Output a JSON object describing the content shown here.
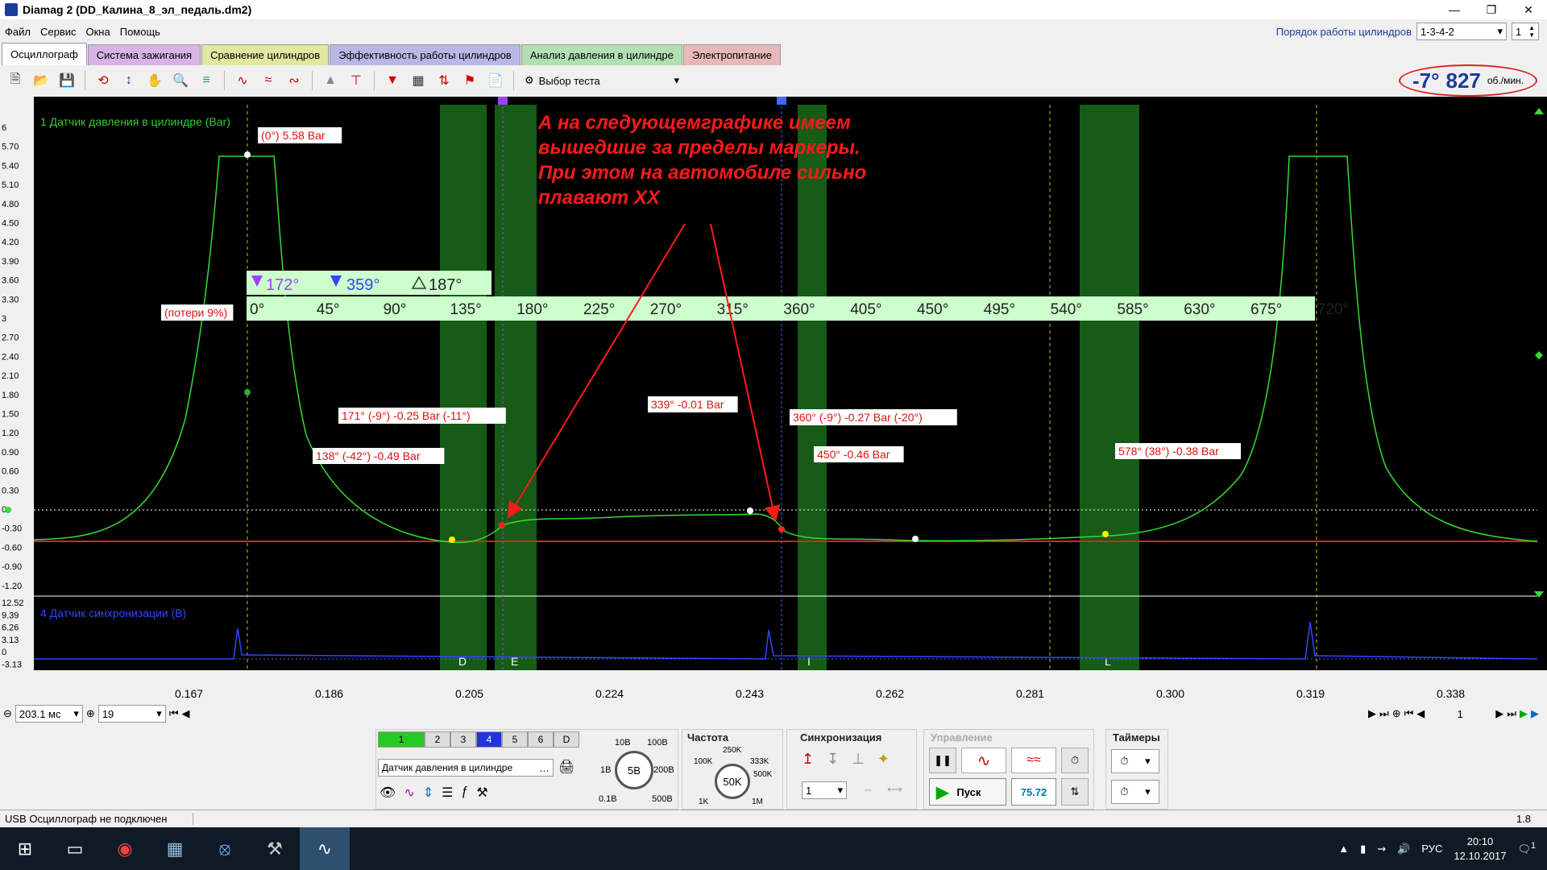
{
  "window": {
    "title": "Diamag 2 (DD_Калина_8_эл_педаль.dm2)"
  },
  "menu": [
    "Файл",
    "Сервис",
    "Окна",
    "Помощь"
  ],
  "cylinder_order": {
    "label": "Порядок работы цилиндров",
    "value": "1-3-4-2",
    "count": "1"
  },
  "tabs": [
    {
      "label": "Осциллограф",
      "color": "#ffffff"
    },
    {
      "label": "Система зажигания",
      "color": "#d9b3e6"
    },
    {
      "label": "Сравнение цилиндров",
      "color": "#e0e8a0"
    },
    {
      "label": "Эффективность работы цилиндров",
      "color": "#b8b8e8"
    },
    {
      "label": "Анализ давления в цилиндре",
      "color": "#b3e0b3"
    },
    {
      "label": "Электропитание",
      "color": "#e8b8b8"
    }
  ],
  "toolbar": {
    "test_select": "Выбор теста"
  },
  "rpm": {
    "angle": "-7°",
    "value": "827",
    "unit": "об./мин."
  },
  "scope": {
    "ch1_label": "1 Датчик давления в цилиндре (Bar)",
    "ch4_label": "4 Датчик синхронизации (В)",
    "y1_ticks": [
      "6",
      "5.70",
      "5.40",
      "5.10",
      "4.80",
      "4.50",
      "4.20",
      "3.90",
      "3.60",
      "3.30",
      "3",
      "2.70",
      "2.40",
      "2.10",
      "1.80",
      "1.50",
      "1.20",
      "0.90",
      "0.60",
      "0.30",
      "0",
      "-0.30",
      "-0.60",
      "-0.90",
      "-1.20"
    ],
    "y2_ticks": [
      "12.52",
      "9.39",
      "6.26",
      "3.13",
      "0",
      "-3.13"
    ],
    "x_ticks": [
      "0.167",
      "0.186",
      "0.205",
      "0.224",
      "0.243",
      "0.262",
      "0.281",
      "0.300",
      "0.319",
      "0.338"
    ],
    "degree_ticks": [
      "0°",
      "45°",
      "90°",
      "135°",
      "180°",
      "225°",
      "270°",
      "315°",
      "360°",
      "405°",
      "450°",
      "495°",
      "540°",
      "585°",
      "630°",
      "675°",
      "720°"
    ],
    "markers": {
      "m1": "172°",
      "m2": "359°",
      "delta": "187°"
    },
    "zones": [
      "D",
      "E",
      "I",
      "L"
    ],
    "annotation": "А на следующемграфике имеем вышедшие за пределы маркеры. При этом на автомобиле сильно плавают ХХ",
    "point_labels": [
      "(0°) 5.58 Bar",
      "(потери 9%)",
      "171° (-9°) -0.25 Bar (-11°)",
      "138° (-42°) -0.49 Bar",
      "339° -0.01 Bar",
      "360° (-9°) -0.27 Bar (-20°)",
      "450° -0.46 Bar",
      "578° (38°) -0.38 Bar"
    ]
  },
  "nav": {
    "timebase": "203.1 мс",
    "frames": "19",
    "page": "1"
  },
  "channels_panel": {
    "buttons": [
      "1",
      "2",
      "3",
      "4",
      "5",
      "6",
      "D"
    ],
    "sensor": "Датчик давления в цилиндре",
    "volt_labels": [
      "10В",
      "100В",
      "1В",
      "200В",
      "0.1В",
      "500В"
    ],
    "volt_value": "5В"
  },
  "frequency": {
    "title": "Частота",
    "labels": [
      "250K",
      "100K",
      "333K",
      "500K",
      "1K",
      "1M"
    ],
    "value": "50K"
  },
  "sync": {
    "title": "Синхронизация",
    "value": "1"
  },
  "control": {
    "title": "Управление",
    "start": "Пуск",
    "fps": "75.72"
  },
  "timers": {
    "title": "Таймеры"
  },
  "status": {
    "message": "USB Осциллограф не подключен",
    "version": "1.8"
  },
  "taskbar": {
    "lang": "РУС",
    "time": "20:10",
    "date": "12.10.2017",
    "notif": "1"
  }
}
